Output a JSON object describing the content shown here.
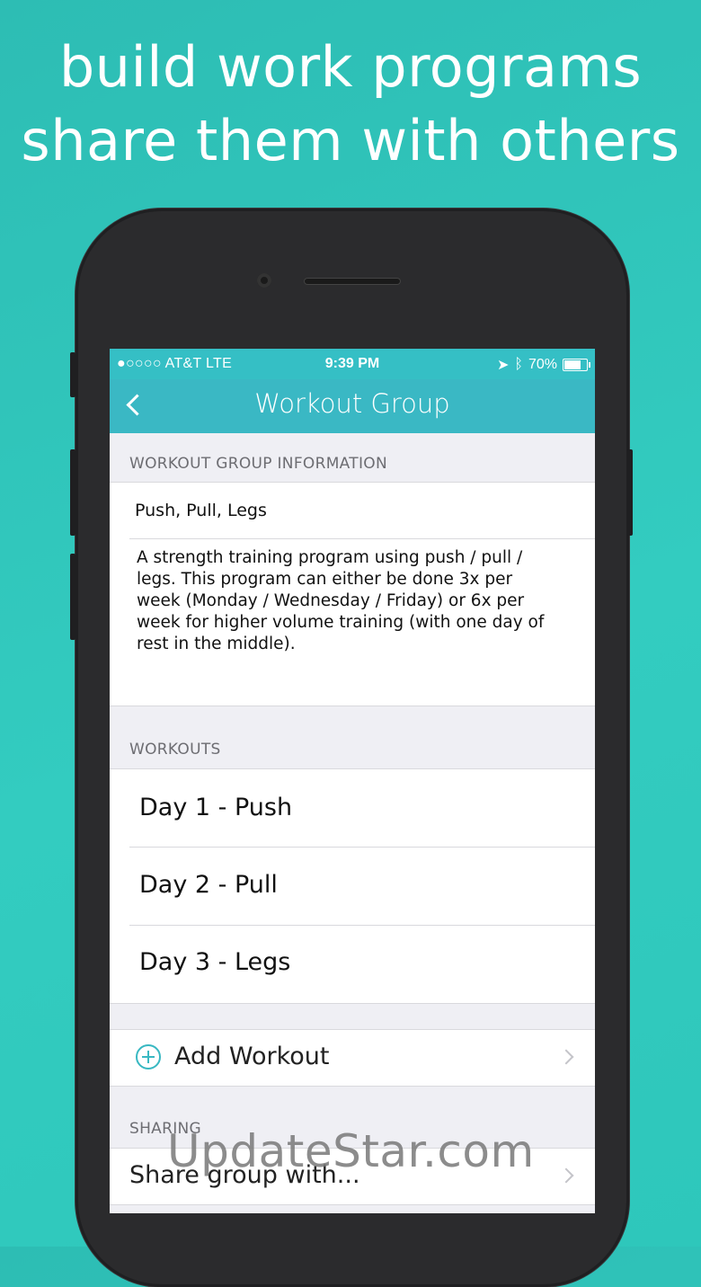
{
  "promo": {
    "line1": "build work programs",
    "line2": "share them with others"
  },
  "status_bar": {
    "carrier": "●○○○○ AT&T  LTE",
    "time": "9:39 PM",
    "battery": "70%"
  },
  "nav": {
    "title": "Workout Group"
  },
  "info_section": {
    "header": "WORKOUT GROUP INFORMATION",
    "name": "Push, Pull, Legs",
    "description": "A strength training program using push / pull / legs.  This program can either be done 3x per week (Monday / Wednesday / Friday) or 6x per week for higher volume training (with one day of rest in the middle)."
  },
  "workouts_section": {
    "header": "WORKOUTS",
    "items": [
      {
        "label": "Day 1 - Push"
      },
      {
        "label": "Day 2 - Pull"
      },
      {
        "label": "Day 3 - Legs"
      }
    ],
    "add_label": "Add Workout"
  },
  "sharing_section": {
    "header": "SHARING",
    "share_label": "Share group with..."
  },
  "watermark": "UpdateStar.com",
  "colors": {
    "background": "#33c7bc",
    "nav_bar": "#3ab8c4",
    "accent": "#38b8c2"
  }
}
